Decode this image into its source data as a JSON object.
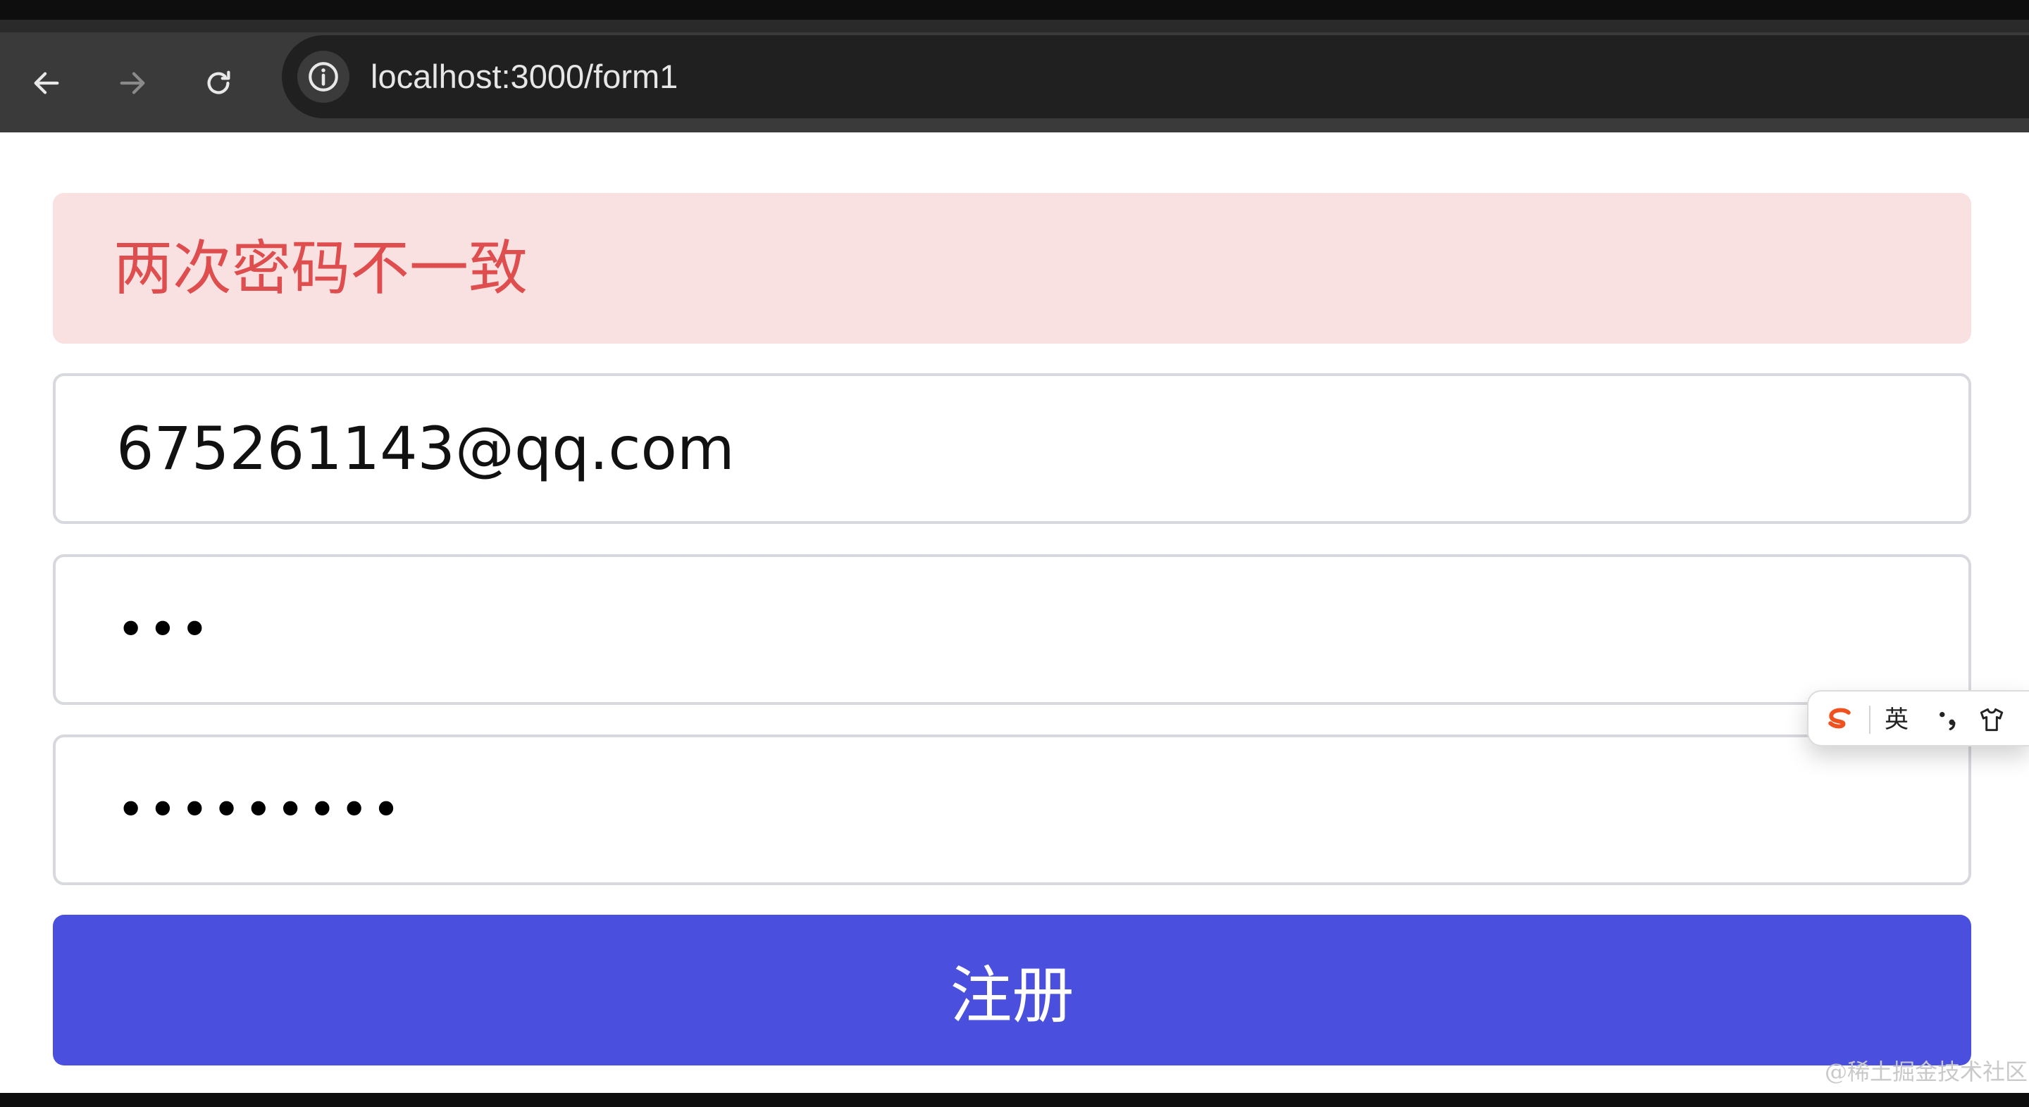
{
  "browser": {
    "url": "localhost:3000/form1",
    "icons": {
      "back": "arrow-left-icon",
      "forward": "arrow-right-icon",
      "reload": "reload-icon",
      "site_info": "info-icon"
    }
  },
  "form": {
    "error_message": "两次密码不一致",
    "email_value": "675261143@qq.com",
    "password_value": "•••",
    "confirm_password_value": "•••••••••",
    "submit_label": "注册"
  },
  "ime": {
    "mode_label": "英",
    "icons": [
      "sogou-logo-icon",
      "punctuation-icon",
      "skin-shirt-icon"
    ]
  },
  "colors": {
    "alert_background": "#f9e0e1",
    "alert_text": "#de4e4f",
    "button_background": "#4b4fdd",
    "field_border": "#d8d9de"
  }
}
